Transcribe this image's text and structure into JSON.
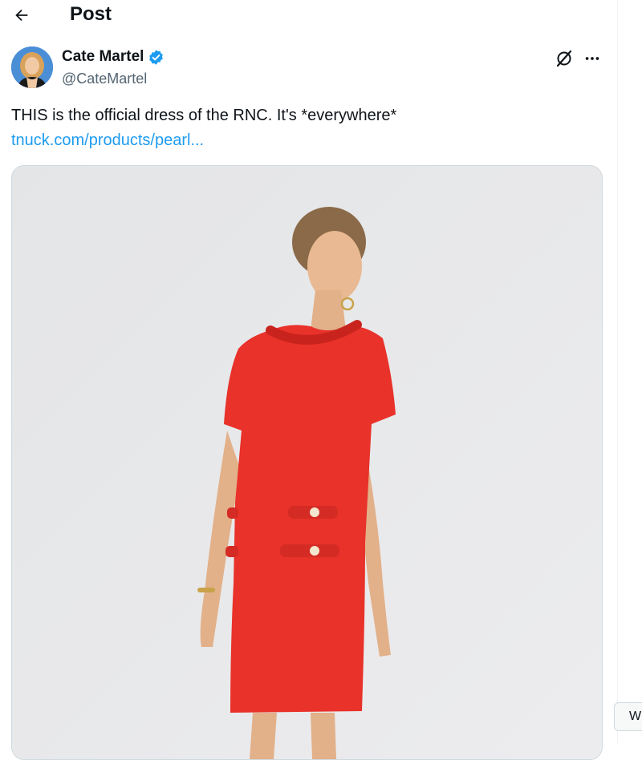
{
  "header": {
    "title": "Post",
    "back_icon": "arrow-left-icon"
  },
  "post": {
    "author": {
      "name": "Cate Martel",
      "handle": "@CateMartel",
      "verified": true,
      "verified_color": "#1d9bf0"
    },
    "actions": {
      "grok_icon": "grok-icon",
      "more_icon": "more-horizontal-icon"
    },
    "text": "THIS is the official dress of the RNC. It's *everywhere*",
    "link": "tnuck.com/products/pearl...",
    "media": {
      "description_icon": "product-photo",
      "dress_color": "#e8322a"
    }
  },
  "side_widget": {
    "label": "W"
  },
  "colors": {
    "accent": "#1d9bf0",
    "text": "#0f1419",
    "muted": "#536471"
  }
}
